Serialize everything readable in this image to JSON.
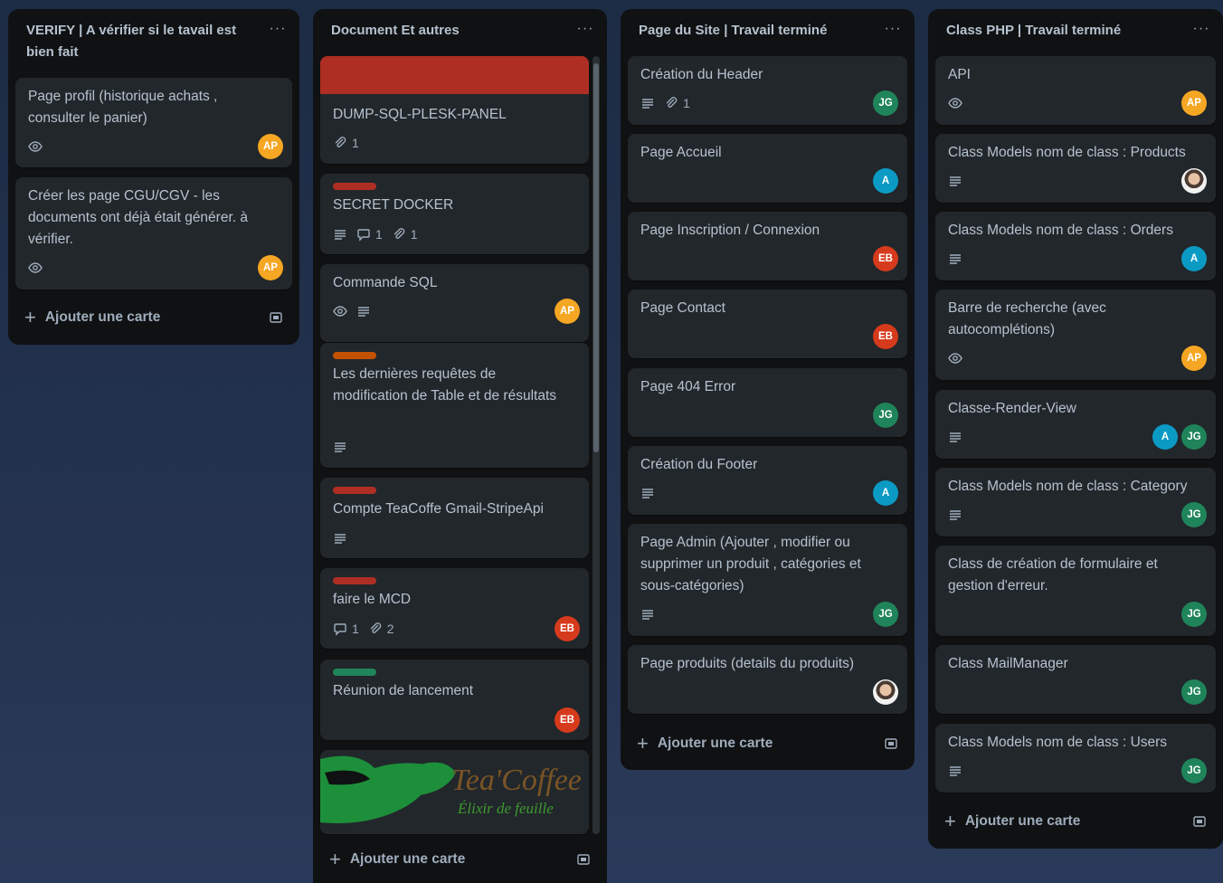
{
  "colors": {
    "label_red": "#ae2e24",
    "label_orange": "#c25100",
    "label_green": "#1f845a",
    "cover_red": "#ae2e24",
    "avatar_ap": "#f5a623",
    "avatar_jg": "#1f845a",
    "avatar_a": "#0b9ac4",
    "avatar_eb": "#d63a1c"
  },
  "add_card_label": "Ajouter une carte",
  "lists": [
    {
      "title": "VERIFY | A vérifier si le tavail est bien fait",
      "cards": [
        {
          "title": "Page profil (historique achats , consulter le panier)",
          "badges": [
            "eye-icon"
          ],
          "avatars": [
            "AP"
          ]
        },
        {
          "title": "Créer les page CGU/CGV - les documents ont déjà était générer. à vérifier.",
          "badges": [
            "eye-icon"
          ],
          "avatars": [
            "AP"
          ]
        }
      ]
    },
    {
      "title": "Document Et autres",
      "cards": [
        {
          "title": "DUMP-SQL-PLESK-PANEL",
          "cover": "red",
          "attachments": "1"
        },
        {
          "title": "SECRET DOCKER",
          "label": "red",
          "comments": "1",
          "attachments": "1"
        },
        {
          "title": "Commande SQL",
          "avatars": [
            "AP"
          ]
        },
        {
          "title": "Les dernières requêtes de modification de Table et de résultats",
          "label": "orange"
        },
        {
          "title": "Compte TeaCoffe Gmail-StripeApi",
          "label": "red"
        },
        {
          "title": "faire le MCD",
          "label": "red",
          "comments": "1",
          "attachments": "2",
          "avatars": [
            "EB"
          ]
        },
        {
          "title": "Réunion de lancement",
          "label": "green",
          "avatars": [
            "EB"
          ]
        },
        {
          "logo_title": "Tea'Coffee",
          "logo_subtitle": "Élixir de feuille"
        }
      ]
    },
    {
      "title": "Page du Site | Travail terminé",
      "cards": [
        {
          "title": "Création du Header",
          "attachments": "1",
          "avatars": [
            "JG"
          ]
        },
        {
          "title": "Page Accueil",
          "avatars": [
            "A"
          ]
        },
        {
          "title": "Page Inscription / Connexion",
          "avatars": [
            "EB"
          ]
        },
        {
          "title": "Page Contact",
          "avatars": [
            "EB"
          ]
        },
        {
          "title": "Page 404 Error",
          "avatars": [
            "JG"
          ]
        },
        {
          "title": "Création du Footer",
          "avatars": [
            "A"
          ]
        },
        {
          "title": "Page Admin (Ajouter , modifier ou supprimer un produit , catégories et sous-catégories)",
          "avatars": [
            "JG"
          ]
        },
        {
          "title": "Page produits (details du produits)",
          "avatars": [
            "photo"
          ]
        }
      ]
    },
    {
      "title": "Class PHP | Travail terminé",
      "cards": [
        {
          "title": "API",
          "avatars": [
            "AP"
          ]
        },
        {
          "title": "Class Models nom de class : Products",
          "avatars": [
            "photo"
          ]
        },
        {
          "title": "Class Models nom de class : Orders",
          "avatars": [
            "A"
          ]
        },
        {
          "title": "Barre de recherche (avec autocomplétions)",
          "avatars": [
            "AP"
          ]
        },
        {
          "title": "Classe-Render-View",
          "avatars": [
            "A",
            "JG"
          ]
        },
        {
          "title": "Class Models nom de class : Category",
          "avatars": [
            "JG"
          ]
        },
        {
          "title": "Class de création de formulaire et gestion d'erreur.",
          "avatars": [
            "JG"
          ]
        },
        {
          "title": "Class MailManager",
          "avatars": [
            "JG"
          ]
        },
        {
          "title": "Class Models nom de class : Users",
          "avatars": [
            "JG"
          ]
        }
      ]
    }
  ]
}
